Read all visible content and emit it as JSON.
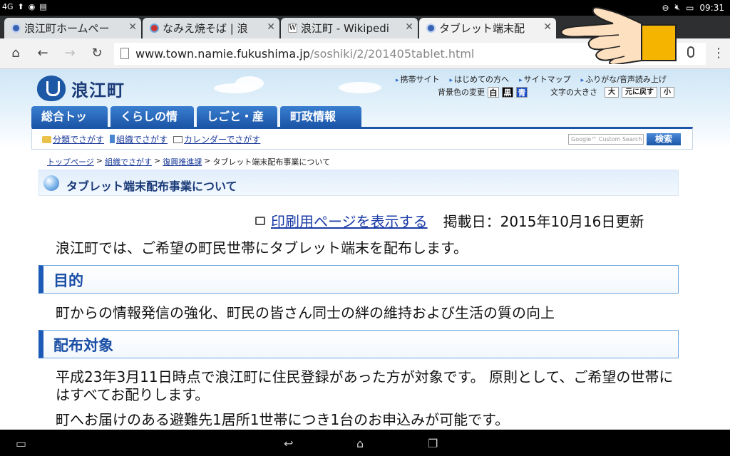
{
  "statusbar": {
    "signal": "4G",
    "time": "09:31"
  },
  "tabs": [
    {
      "title": "浪江町ホームペー",
      "favicon": "town-favicon"
    },
    {
      "title": "なみえ焼そば | 浪",
      "favicon": "namie-favicon"
    },
    {
      "title": "浪江町 - Wikipedi",
      "favicon": "wikipedia-favicon"
    },
    {
      "title": "タブレット端末配",
      "favicon": "town-favicon"
    }
  ],
  "omnibox": {
    "domain": "www.town.namie.fukushima.jp",
    "path": "/soshiki/2/201405tablet.html"
  },
  "site": {
    "name": "浪江町",
    "top_links": [
      "携帯サイト",
      "はじめての方へ",
      "サイトマップ",
      "ふりがな/音声読み上げ"
    ],
    "bgcolor_label": "背景色の変更",
    "bgcolor_options": [
      "白",
      "黒",
      "青"
    ],
    "fontsize_label": "文字の大きさ",
    "fontsize_options": [
      "大",
      "元に戻す",
      "小"
    ],
    "nav": [
      "総合トップ",
      "くらしの情報",
      "しごと・産業",
      "町政情報"
    ],
    "sublinks": [
      "分類でさがす",
      "組織でさがす",
      "カレンダーでさがす"
    ],
    "search_placeholder": "Google™ Custom Search",
    "search_button": "検索"
  },
  "breadcrumb": [
    "トップページ",
    "組織でさがす",
    "復興推進課",
    "タブレット端末配布事業について"
  ],
  "page_title": "タブレット端末配布事業について",
  "print_link": "印刷用ページを表示する",
  "posted": "掲載日：2015年10月16日更新",
  "intro": "浪江町では、ご希望の町民世帯にタブレット端末を配布します。",
  "sections": [
    {
      "heading": "目的",
      "body": "町からの情報発信の強化、町民の皆さん同士の絆の維持および生活の質の向上"
    },
    {
      "heading": "配布対象",
      "body": "平成23年3月11日時点で浪江町に住民登録があった方が対象です。 原則として、ご希望の世帯にはすべてお配りします。",
      "body2": "町へお届けのある避難先1居所1世帯につき1台のお申込みが可能です。"
    }
  ]
}
